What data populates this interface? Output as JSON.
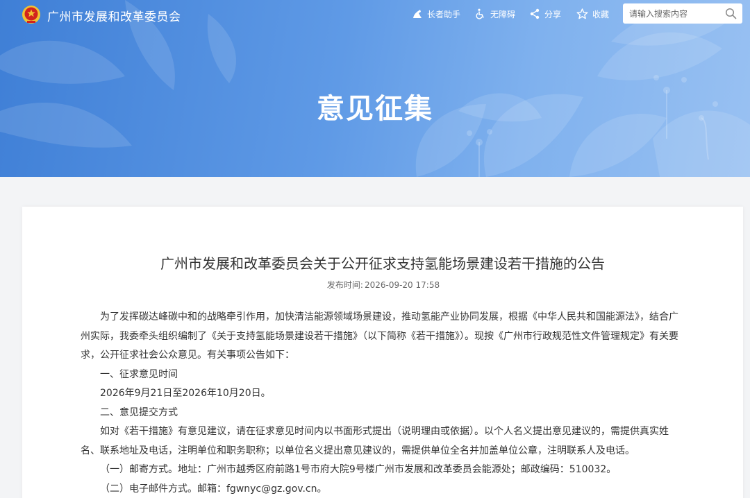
{
  "header": {
    "site_title": "广州市发展和改革委员会",
    "tools": {
      "elder": "长者助手",
      "accessibility": "无障碍",
      "share": "分享",
      "favorite": "收藏"
    },
    "search": {
      "placeholder": "请输入搜索内容",
      "value": ""
    }
  },
  "banner": {
    "heading": "意见征集"
  },
  "article": {
    "title": "广州市发展和改革委员会关于公开征求支持氢能场景建设若干措施的公告",
    "published_label": "发布时间:",
    "published_time": "2026-09-20 17:58",
    "paragraphs": [
      "为了发挥碳达峰碳中和的战略牵引作用，加快清洁能源领域场景建设，推动氢能产业协同发展，根据《中华人民共和国能源法》，结合广州实际，我委牵头组织编制了《关于支持氢能场景建设若干措施》（以下简称《若干措施》）。现按《广州市行政规范性文件管理规定》有关要求，公开征求社会公众意见。有关事项公告如下：",
      "一、征求意见时间",
      "2026年9月21日至2026年10月20日。",
      "二、意见提交方式",
      "如对《若干措施》有意见建议，请在征求意见时间内以书面形式提出（说明理由或依据）。以个人名义提出意见建议的，需提供真实姓名、联系地址及电话，注明单位和职务职称；以单位名义提出意见建议的，需提供单位全名并加盖单位公章，注明联系人及电话。",
      "（一）邮寄方式。地址：广州市越秀区府前路1号市府大院9号楼广州市发展和改革委员会能源处；邮政编码：510032。",
      "（二）电子邮件方式。邮箱：fgwnyc@gz.gov.cn。"
    ]
  },
  "colors": {
    "banner_blue": "#3f7fd6",
    "card_bg": "#ffffff",
    "page_bg": "#f3f4f6",
    "emblem_red": "#d2231d",
    "emblem_gold": "#f2c232"
  }
}
